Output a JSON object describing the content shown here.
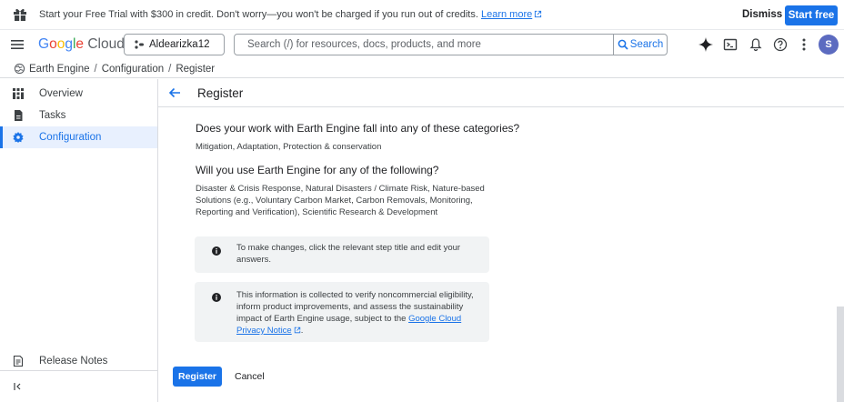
{
  "banner": {
    "message": "Start your Free Trial with $300 in credit. Don't worry—you won't be charged if you run out of credits.",
    "learn_more": "Learn more",
    "dismiss": "Dismiss",
    "start_free": "Start free"
  },
  "header": {
    "logo_google": "Google",
    "logo_cloud": " Cloud",
    "project": "Aldearizka12",
    "search_placeholder": "Search (/) for resources, docs, products, and more",
    "search_button": "Search",
    "avatar_letter": "S"
  },
  "breadcrumb": {
    "items": [
      "Earth Engine",
      "Configuration",
      "Register"
    ],
    "separator": "/"
  },
  "sidebar": {
    "items": [
      {
        "label": "Overview",
        "icon": "grid-icon"
      },
      {
        "label": "Tasks",
        "icon": "doc-icon"
      },
      {
        "label": "Configuration",
        "icon": "gear-icon",
        "active": true
      }
    ],
    "release_notes": "Release Notes",
    "collapse_icon": "collapse-icon"
  },
  "main": {
    "title": "Register",
    "q1": "Does your work with Earth Engine fall into any of these categories?",
    "a1": "Mitigation, Adaptation, Protection & conservation",
    "q2": "Will you use Earth Engine for any of the following?",
    "a2": "Disaster & Crisis Response, Natural Disasters / Climate Risk, Nature-based Solutions (e.g., Voluntary Carbon Market, Carbon Removals, Monitoring, Reporting and Verification), Scientific Research & Development",
    "info1": "To make changes, click the relevant step title and edit your answers.",
    "info2": "This information is collected to verify noncommercial eligibility, inform product improvements, and assess the sustainability impact of Earth Engine usage, subject to the",
    "info2_link": "Google Cloud Privacy Notice",
    "info2_end": ".",
    "register": "Register",
    "cancel": "Cancel"
  },
  "colors": {
    "accent": "#1a73e8",
    "active_bg": "#e8f0fe",
    "info_bg": "#f1f3f4"
  }
}
